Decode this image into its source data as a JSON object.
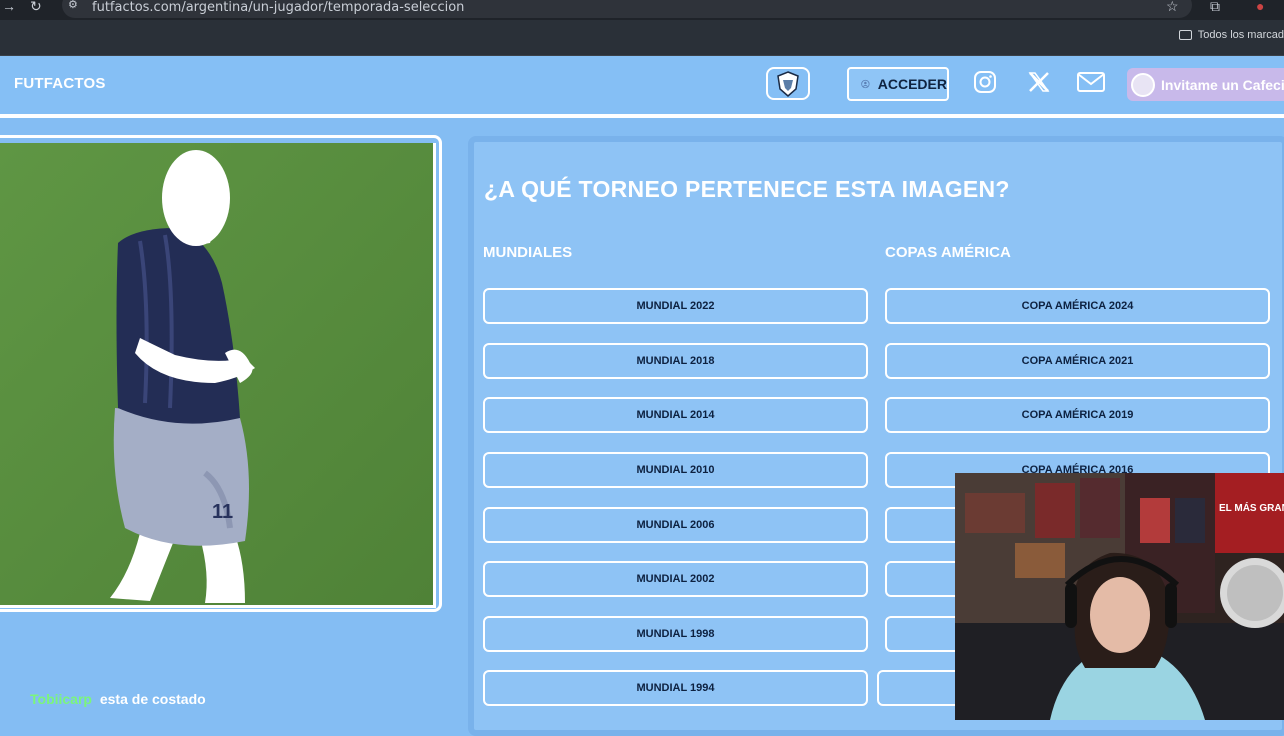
{
  "browser": {
    "url": "futfactos.com/argentina/un-jugador/temporada-seleccion",
    "bookmarks_folder": "Todos los marcad"
  },
  "header": {
    "logo": "FUTFACTOS",
    "login_button": "ACCEDER",
    "donate_button": "Invitame un Cafecit"
  },
  "quiz": {
    "question": "¿A QUÉ TORNEO PERTENECE ESTA IMAGEN?",
    "columns": [
      {
        "heading": "MUNDIALES",
        "options": [
          "MUNDIAL 2022",
          "MUNDIAL 2018",
          "MUNDIAL 2014",
          "MUNDIAL 2010",
          "MUNDIAL 2006",
          "MUNDIAL 2002",
          "MUNDIAL 1998",
          "MUNDIAL 1994"
        ]
      },
      {
        "heading": "COPAS AMÉRICA",
        "options": [
          "COPA AMÉRICA 2024",
          "COPA AMÉRICA 2021",
          "COPA AMÉRICA 2019",
          "COPA AMÉRICA 2016"
        ]
      }
    ]
  },
  "player": {
    "shirt_number": "11"
  },
  "webcam": {
    "poster_text": "EL MÁS GRANDE DE AMÉRICA"
  },
  "chat": {
    "user": "Tobiicarp",
    "message": "esta de costado"
  }
}
